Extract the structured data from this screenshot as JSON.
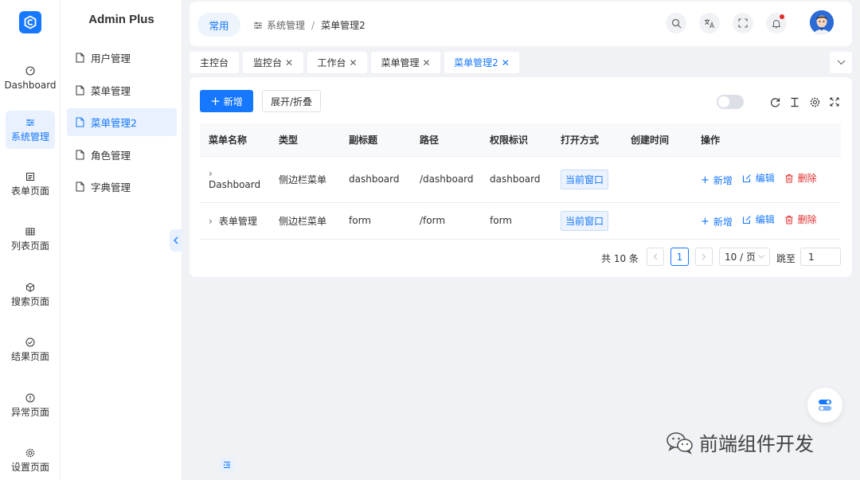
{
  "brand": "Admin Plus",
  "rail": [
    {
      "label": "Dashboard",
      "icon": "dashboard-icon"
    },
    {
      "label": "系统管理",
      "icon": "sliders-icon",
      "active": true
    },
    {
      "label": "表单页面",
      "icon": "form-icon"
    },
    {
      "label": "列表页面",
      "icon": "table-icon"
    },
    {
      "label": "搜索页面",
      "icon": "cube-icon"
    },
    {
      "label": "结果页面",
      "icon": "check-circle-icon"
    },
    {
      "label": "异常页面",
      "icon": "warning-circle-icon"
    },
    {
      "label": "设置页面",
      "icon": "gear-icon"
    }
  ],
  "submenu": [
    {
      "label": "用户管理",
      "icon": "file-icon"
    },
    {
      "label": "菜单管理",
      "icon": "file-icon"
    },
    {
      "label": "菜单管理2",
      "icon": "file-icon",
      "active": true
    },
    {
      "label": "角色管理",
      "icon": "file-icon"
    },
    {
      "label": "字典管理",
      "icon": "file-icon"
    }
  ],
  "header": {
    "pill": "常用",
    "breadcrumb": [
      "系统管理",
      "/",
      "菜单管理2"
    ]
  },
  "tabs": [
    {
      "label": "主控台",
      "closable": false
    },
    {
      "label": "监控台",
      "closable": true
    },
    {
      "label": "工作台",
      "closable": true
    },
    {
      "label": "菜单管理",
      "closable": true
    },
    {
      "label": "菜单管理2",
      "closable": true,
      "active": true
    }
  ],
  "toolbar": {
    "add": "新增",
    "expand": "展开/折叠"
  },
  "table": {
    "columns": [
      "菜单名称",
      "类型",
      "副标题",
      "路径",
      "权限标识",
      "打开方式",
      "创建时间",
      "操作"
    ],
    "rows": [
      {
        "name": "Dashboard",
        "type": "侧边栏菜单",
        "subtitle": "dashboard",
        "path": "/dashboard",
        "perm": "dashboard",
        "open": "当前窗口",
        "created": ""
      },
      {
        "name": "表单管理",
        "type": "侧边栏菜单",
        "subtitle": "form",
        "path": "/form",
        "perm": "form",
        "open": "当前窗口",
        "created": ""
      }
    ],
    "actions": {
      "add": "新增",
      "edit": "编辑",
      "delete": "删除"
    }
  },
  "pagination": {
    "total": "共 10 条",
    "current": "1",
    "size": "10 / 页",
    "jump_label": "跳至",
    "jump_value": "1"
  },
  "watermark": "前端组件开发",
  "colors": {
    "primary": "#1677ff",
    "danger": "#e02e2e"
  }
}
